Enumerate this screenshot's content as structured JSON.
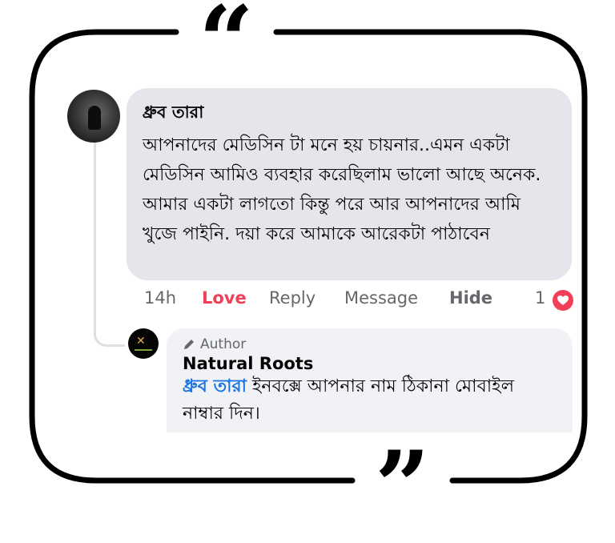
{
  "comment": {
    "author": "ধ্রুব তারা",
    "text": "আপনাদের মেডিসিন টা মনে হয় চায়নার..এমন একটা মেডিসিন আমিও ব্যবহার করেছিলাম ভালো আছে অনেক. আমার একটা লাগতো কিন্তু পরে আর আপনাদের আমি খুজে পাইনি. দয়া করে আমাকে আরেকটা পাঠাবেন",
    "time": "14h",
    "actions": {
      "love": "Love",
      "reply": "Reply",
      "message": "Message",
      "hide": "Hide"
    },
    "reaction_count": "1",
    "reaction_icon": "heart-icon"
  },
  "reply": {
    "badge": "Author",
    "author": "Natural Roots",
    "mention": "ধ্রুব তারা",
    "text": " ইনবক্সে আপনার নাম ঠিকানা মোবাইল নাম্বার দিন।"
  },
  "decor": {
    "open_quote": "“",
    "close_quote": "”"
  },
  "colors": {
    "love": "#f33e58",
    "mention": "#1b74e4",
    "bubble_main": "#e4e6eb",
    "bubble_reply": "#f0f2f5"
  }
}
